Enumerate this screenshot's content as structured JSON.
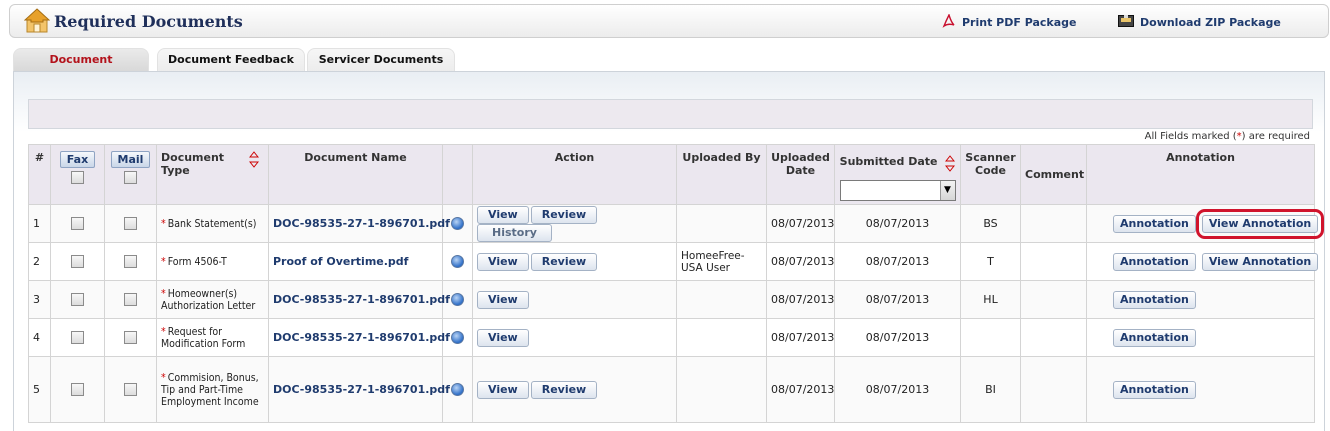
{
  "header": {
    "title": "Required Documents",
    "print_pdf": "Print PDF Package",
    "download_zip": "Download ZIP Package"
  },
  "tabs": [
    {
      "label": "Document",
      "active": true
    },
    {
      "label": "Document Feedback",
      "active": false
    },
    {
      "label": "Servicer Documents",
      "active": false
    }
  ],
  "required_note": {
    "prefix": "All Fields marked (",
    "star": "*",
    "suffix": ") are required"
  },
  "table": {
    "headers": {
      "num": "#",
      "fax": "Fax",
      "mail": "Mail",
      "doc_type": "Document Type",
      "doc_name": "Document Name",
      "action": "Action",
      "uploaded_by": "Uploaded By",
      "uploaded_date": "Uploaded Date",
      "submitted_date": "Submitted Date",
      "scanner_code": "Scanner Code",
      "comment": "Comment",
      "annotation": "Annotation"
    },
    "buttons": {
      "view": "View",
      "review": "Review",
      "history": "History",
      "annotation": "Annotation",
      "view_annotation": "View Annotation"
    },
    "rows": [
      {
        "num": "1",
        "doc_type": "Bank Statement(s)",
        "doc_name": "DOC-98535-27-1-896701.pdf",
        "uploaded_by": "",
        "uploaded_date": "08/07/2013",
        "submitted_date": "08/07/2013",
        "scanner_code": "BS",
        "comment": ""
      },
      {
        "num": "2",
        "doc_type": "Form 4506-T",
        "doc_name": "Proof of Overtime.pdf",
        "uploaded_by": "HomeeFree-USA User",
        "uploaded_date": "08/07/2013",
        "submitted_date": "08/07/2013",
        "scanner_code": "T",
        "comment": ""
      },
      {
        "num": "3",
        "doc_type": "Homeowner(s) Authorization Letter",
        "doc_name": "DOC-98535-27-1-896701.pdf",
        "uploaded_by": "",
        "uploaded_date": "08/07/2013",
        "submitted_date": "08/07/2013",
        "scanner_code": "HL",
        "comment": ""
      },
      {
        "num": "4",
        "doc_type": "Request for Modification Form",
        "doc_name": "DOC-98535-27-1-896701.pdf",
        "uploaded_by": "",
        "uploaded_date": "08/07/2013",
        "submitted_date": "08/07/2013",
        "scanner_code": "",
        "comment": ""
      },
      {
        "num": "5",
        "doc_type": "Commision, Bonus, Tip and Part-Time Employment Income",
        "doc_name": "DOC-98535-27-1-896701.pdf",
        "uploaded_by": "",
        "uploaded_date": "08/07/2013",
        "submitted_date": "08/07/2013",
        "scanner_code": "BI",
        "comment": ""
      }
    ]
  }
}
